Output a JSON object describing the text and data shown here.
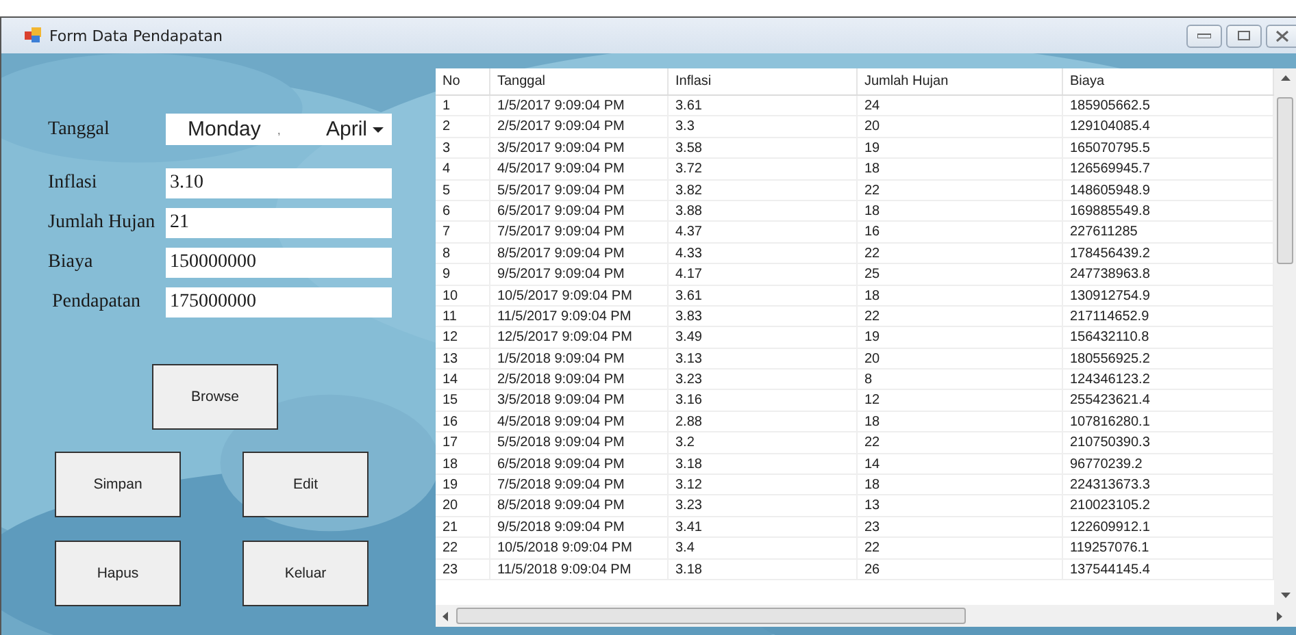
{
  "window": {
    "title": "Form Data Pendapatan"
  },
  "form": {
    "date_label": "Tanggal",
    "date_picker": {
      "day": "Monday",
      "separator": ",",
      "month": "April"
    },
    "fields": [
      {
        "label": "Inflasi",
        "value": "3.10"
      },
      {
        "label": "Jumlah Hujan",
        "value": "21"
      },
      {
        "label": "Biaya",
        "value": "150000000"
      },
      {
        "label": "Pendapatan",
        "value": "175000000"
      }
    ],
    "browse_button": "Browse",
    "buttons": [
      "Simpan",
      "Edit",
      "Hapus",
      "Keluar"
    ]
  },
  "table": {
    "columns": [
      "No",
      "Tanggal",
      "Inflasi",
      "Jumlah Hujan",
      "Biaya"
    ],
    "rows": [
      [
        "1",
        "1/5/2017 9:09:04 PM",
        "3.61",
        "24",
        "185905662.5"
      ],
      [
        "2",
        "2/5/2017 9:09:04 PM",
        "3.3",
        "20",
        "129104085.4"
      ],
      [
        "3",
        "3/5/2017 9:09:04 PM",
        "3.58",
        "19",
        "165070795.5"
      ],
      [
        "4",
        "4/5/2017 9:09:04 PM",
        "3.72",
        "18",
        "126569945.7"
      ],
      [
        "5",
        "5/5/2017 9:09:04 PM",
        "3.82",
        "22",
        "148605948.9"
      ],
      [
        "6",
        "6/5/2017 9:09:04 PM",
        "3.88",
        "18",
        "169885549.8"
      ],
      [
        "7",
        "7/5/2017 9:09:04 PM",
        "4.37",
        "16",
        "227611285"
      ],
      [
        "8",
        "8/5/2017 9:09:04 PM",
        "4.33",
        "22",
        "178456439.2"
      ],
      [
        "9",
        "9/5/2017 9:09:04 PM",
        "4.17",
        "25",
        "247738963.8"
      ],
      [
        "10",
        "10/5/2017 9:09:04 PM",
        "3.61",
        "18",
        "130912754.9"
      ],
      [
        "11",
        "11/5/2017 9:09:04 PM",
        "3.83",
        "22",
        "217114652.9"
      ],
      [
        "12",
        "12/5/2017 9:09:04 PM",
        "3.49",
        "19",
        "156432110.8"
      ],
      [
        "13",
        "1/5/2018 9:09:04 PM",
        "3.13",
        "20",
        "180556925.2"
      ],
      [
        "14",
        "2/5/2018 9:09:04 PM",
        "3.23",
        "8",
        "124346123.2"
      ],
      [
        "15",
        "3/5/2018 9:09:04 PM",
        "3.16",
        "12",
        "255423621.4"
      ],
      [
        "16",
        "4/5/2018 9:09:04 PM",
        "2.88",
        "18",
        "107816280.1"
      ],
      [
        "17",
        "5/5/2018 9:09:04 PM",
        "3.2",
        "22",
        "210750390.3"
      ],
      [
        "18",
        "6/5/2018 9:09:04 PM",
        "3.18",
        "14",
        "96770239.2"
      ],
      [
        "19",
        "7/5/2018 9:09:04 PM",
        "3.12",
        "18",
        "224313673.3"
      ],
      [
        "20",
        "8/5/2018 9:09:04 PM",
        "3.23",
        "13",
        "210023105.2"
      ],
      [
        "21",
        "9/5/2018 9:09:04 PM",
        "3.41",
        "23",
        "122609912.1"
      ],
      [
        "22",
        "10/5/2018 9:09:04 PM",
        "3.4",
        "22",
        "119257076.1"
      ],
      [
        "23",
        "11/5/2018 9:09:04 PM",
        "3.18",
        "26",
        "137544145.4"
      ]
    ]
  }
}
